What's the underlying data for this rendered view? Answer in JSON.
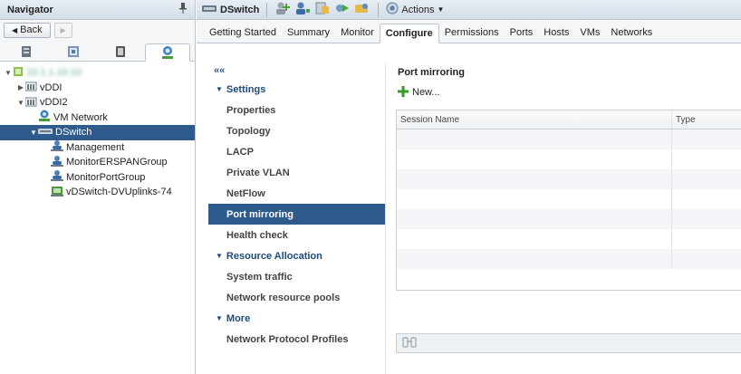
{
  "navigator": {
    "title": "Navigator",
    "back_label": "Back",
    "tree": [
      {
        "label": "",
        "level": 0,
        "twisty": "open",
        "icon": "datacenter-icon"
      },
      {
        "label": "vDDI",
        "level": 1,
        "twisty": "closed",
        "icon": "folder-icon"
      },
      {
        "label": "vDDI2",
        "level": 1,
        "twisty": "open",
        "icon": "folder-icon"
      },
      {
        "label": "VM Network",
        "level": 2,
        "twisty": "none",
        "icon": "network-icon"
      },
      {
        "label": "DSwitch",
        "level": 2,
        "twisty": "open",
        "icon": "dswitch-icon",
        "selected": true
      },
      {
        "label": "Management",
        "level": 3,
        "twisty": "none",
        "icon": "portgroup-icon"
      },
      {
        "label": "MonitorERSPANGroup",
        "level": 3,
        "twisty": "none",
        "icon": "portgroup-icon"
      },
      {
        "label": "MonitorPortGroup",
        "level": 3,
        "twisty": "none",
        "icon": "portgroup-icon"
      },
      {
        "label": "vDSwitch-DVUplinks-74",
        "level": 3,
        "twisty": "none",
        "icon": "uplink-icon"
      }
    ]
  },
  "toolbar": {
    "object_name": "DSwitch",
    "actions_label": "Actions"
  },
  "tabs": [
    "Getting Started",
    "Summary",
    "Monitor",
    "Configure",
    "Permissions",
    "Ports",
    "Hosts",
    "VMs",
    "Networks"
  ],
  "active_tab": "Configure",
  "settings": {
    "collapse_glyph": "««",
    "groups": [
      {
        "label": "Settings",
        "items": [
          "Properties",
          "Topology",
          "LACP",
          "Private VLAN",
          "NetFlow",
          "Port mirroring",
          "Health check"
        ]
      },
      {
        "label": "Resource Allocation",
        "items": [
          "System traffic",
          "Network resource pools"
        ]
      },
      {
        "label": "More",
        "items": [
          "Network Protocol Profiles"
        ]
      }
    ],
    "active_item": "Port mirroring"
  },
  "content": {
    "title": "Port mirroring",
    "new_label": "New...",
    "columns": [
      "Session Name",
      "Type"
    ],
    "rows": []
  }
}
